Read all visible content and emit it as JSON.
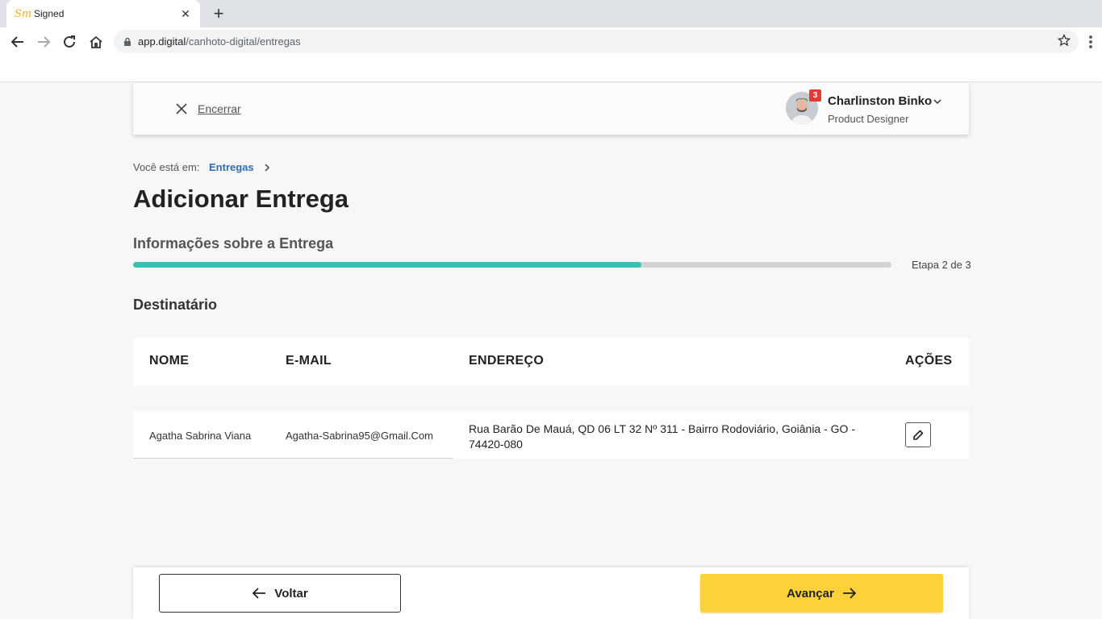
{
  "browser": {
    "tab_title": "Signed",
    "tab_logo": "Sm",
    "url_host": "app.digital",
    "url_path": "/canhoto-digital/entregas"
  },
  "header": {
    "close_label": "Encerrar",
    "notification_count": "3",
    "user_name": "Charlinston Binko",
    "user_role": "Product Designer"
  },
  "breadcrumb": {
    "prefix": "Você está em:",
    "link": "Entregas"
  },
  "page": {
    "title": "Adicionar Entrega",
    "section_title": "Informações sobre a Entrega",
    "progress_fraction": 0.67,
    "step_label": "Etapa 2 de 3",
    "recipient_title": "Destinatário"
  },
  "table": {
    "headers": [
      "NOME",
      "E-MAIL",
      "ENDEREÇO",
      "AÇÕES"
    ],
    "rows": [
      {
        "name": "Agatha Sabrina Viana",
        "email": "Agatha-Sabrina95@Gmail.Com",
        "address": "Rua Barão De Mauá, QD 06 LT 32 Nº 311 - Bairro Rodoviário, Goiânia - GO - 74420-080"
      }
    ]
  },
  "footer": {
    "back_label": "Voltar",
    "next_label": "Avançar"
  },
  "colors": {
    "accent_teal": "#35c2b3",
    "primary_yellow": "#fdd13a",
    "link_blue": "#2d6db5",
    "badge_red": "#e53935"
  }
}
